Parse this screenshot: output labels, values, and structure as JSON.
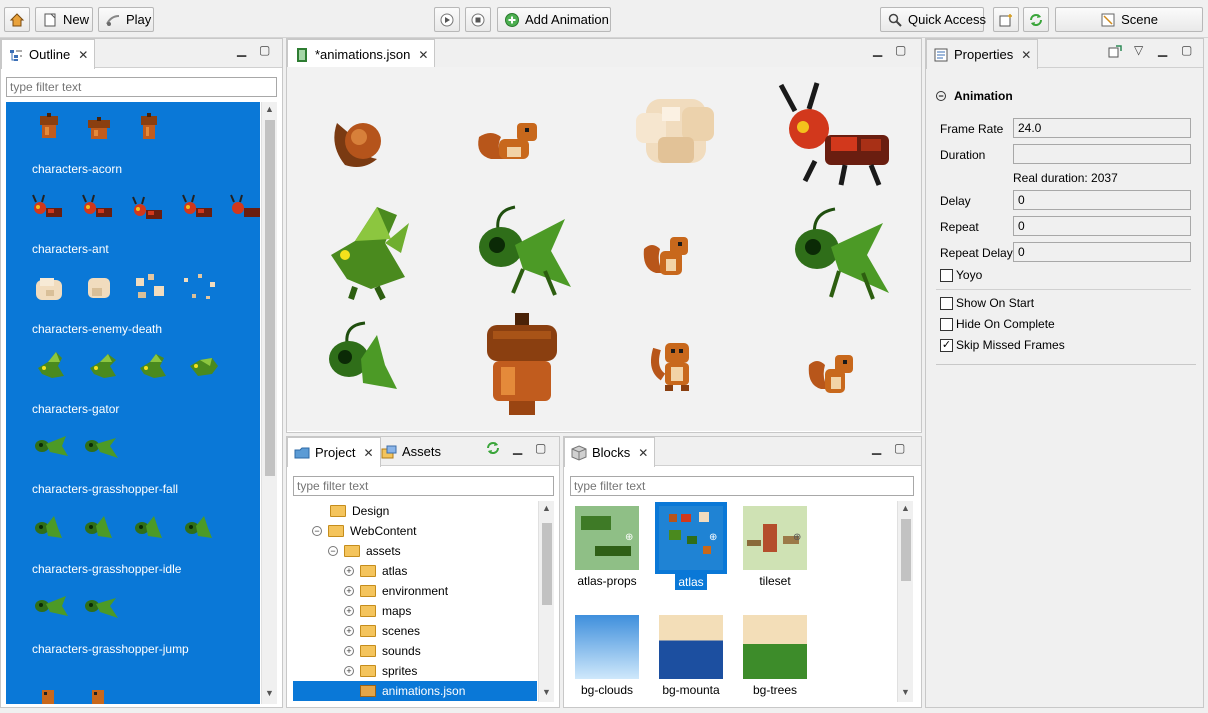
{
  "toolbar": {
    "new_label": "New",
    "play_label": "Play",
    "add_animation_label": "Add Animation",
    "quick_access_label": "Quick Access",
    "scene_label": "Scene"
  },
  "outline": {
    "tab_label": "Outline",
    "filter_placeholder": "type filter text",
    "items": [
      {
        "label": "characters-acorn"
      },
      {
        "label": "characters-ant"
      },
      {
        "label": "characters-enemy-death"
      },
      {
        "label": "characters-gator"
      },
      {
        "label": "characters-grasshopper-fall"
      },
      {
        "label": "characters-grasshopper-idle"
      },
      {
        "label": "characters-grasshopper-jump"
      }
    ]
  },
  "editor": {
    "tab_label": "*animations.json"
  },
  "project": {
    "tab_label": "Project",
    "assets_tab_label": "Assets",
    "filter_placeholder": "type filter text",
    "tree": [
      {
        "label": "Design"
      },
      {
        "label": "WebContent"
      },
      {
        "label": "assets"
      },
      {
        "label": "atlas"
      },
      {
        "label": "environment"
      },
      {
        "label": "maps"
      },
      {
        "label": "scenes"
      },
      {
        "label": "sounds"
      },
      {
        "label": "sprites"
      },
      {
        "label": "animations.json"
      }
    ]
  },
  "blocks": {
    "tab_label": "Blocks",
    "filter_placeholder": "type filter text",
    "items": [
      {
        "label": "atlas-props"
      },
      {
        "label": "atlas"
      },
      {
        "label": "tileset"
      },
      {
        "label": "bg-clouds"
      },
      {
        "label": "bg-mounta"
      },
      {
        "label": "bg-trees"
      }
    ]
  },
  "properties": {
    "tab_label": "Properties",
    "section_title": "Animation",
    "frame_rate_label": "Frame Rate",
    "frame_rate_value": "24.0",
    "duration_label": "Duration",
    "duration_value": "",
    "real_duration_text": "Real duration: 2037",
    "delay_label": "Delay",
    "delay_value": "0",
    "repeat_label": "Repeat",
    "repeat_value": "0",
    "repeat_delay_label": "Repeat Delay",
    "repeat_delay_value": "0",
    "yoyo_label": "Yoyo",
    "yoyo_checked": false,
    "show_on_start_label": "Show On Start",
    "show_on_start_checked": false,
    "hide_on_complete_label": "Hide On Complete",
    "hide_on_complete_checked": false,
    "skip_missed_frames_label": "Skip Missed Frames",
    "skip_missed_frames_checked": true
  },
  "colors": {
    "selection": "#0a78d7",
    "acorn": "#b5541b",
    "ant": "#d2381c",
    "gator": "#4a8a1e",
    "grasshopper": "#2f6e19",
    "squirrel": "#c8681c",
    "smoke": "#f1dcbe"
  }
}
